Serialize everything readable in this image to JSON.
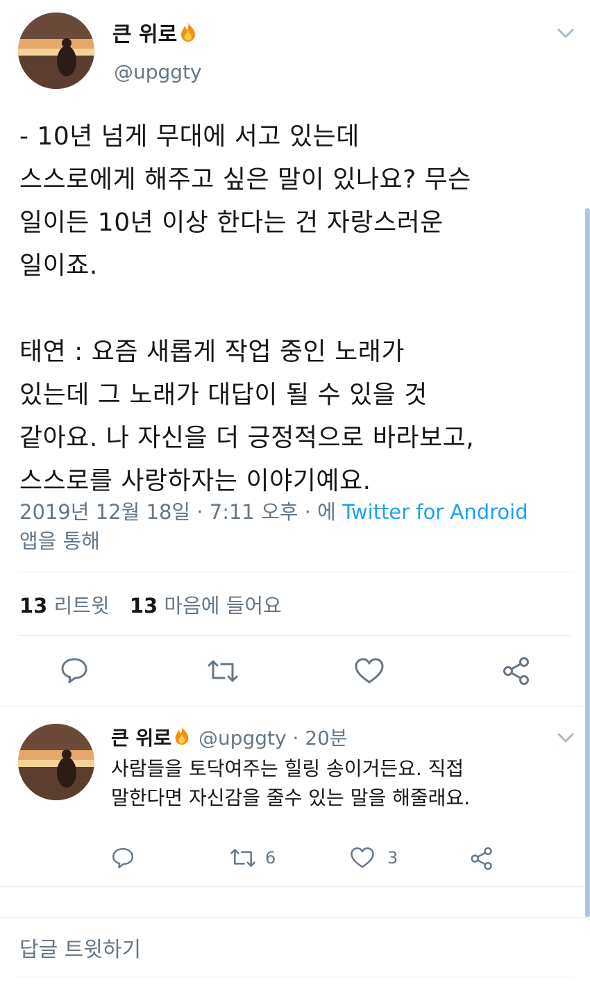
{
  "tweet": {
    "author_name": "큰 위로",
    "author_handle": "@upggty",
    "body_lines": [
      "- 10년 넘게 무대에 서고 있는데",
      "스스로에게 해주고 싶은 말이 있나요? 무슨",
      "일이든 10년 이상 한다는 건 자랑스러운",
      "일이죠.",
      "",
      "태연 : 요즘 새롭게 작업 중인 노래가",
      "있는데 그 노래가 대답이 될 수 있을 것",
      "같아요. 나 자신을 더 긍정적으로 바라보고,",
      "스스로를 사랑하자는 이야기예요."
    ],
    "meta_prefix": "2019년 12월 18일 · 7:11 오후 · 에 ",
    "meta_source": "Twitter for Android",
    "meta_suffix": "앱을 통해",
    "stats": {
      "retweets_count": "13",
      "retweets_label": "리트윗",
      "likes_count": "13",
      "likes_label": "마음에 들어요"
    }
  },
  "reply": {
    "author_name": "큰 위로",
    "author_handle": "@upggty",
    "time": "· 20분",
    "body_lines": [
      "사람들을 토닥여주는 힐링 송이거든요. 직접",
      "말한다면 자신감을 줄수 있는 말을 해줄래요."
    ],
    "retweet_count": "6",
    "like_count": "3"
  },
  "compose": {
    "placeholder": "답글 트윗하기"
  },
  "icons": {
    "reply": "reply-icon",
    "retweet": "retweet-icon",
    "like": "heart-icon",
    "share": "share-icon",
    "caret": "chevron-down-icon",
    "emoji": "fire-icon"
  },
  "colors": {
    "text": "#14171a",
    "muted": "#657786",
    "link": "#1da1f2",
    "divider": "#e6ecf0"
  }
}
